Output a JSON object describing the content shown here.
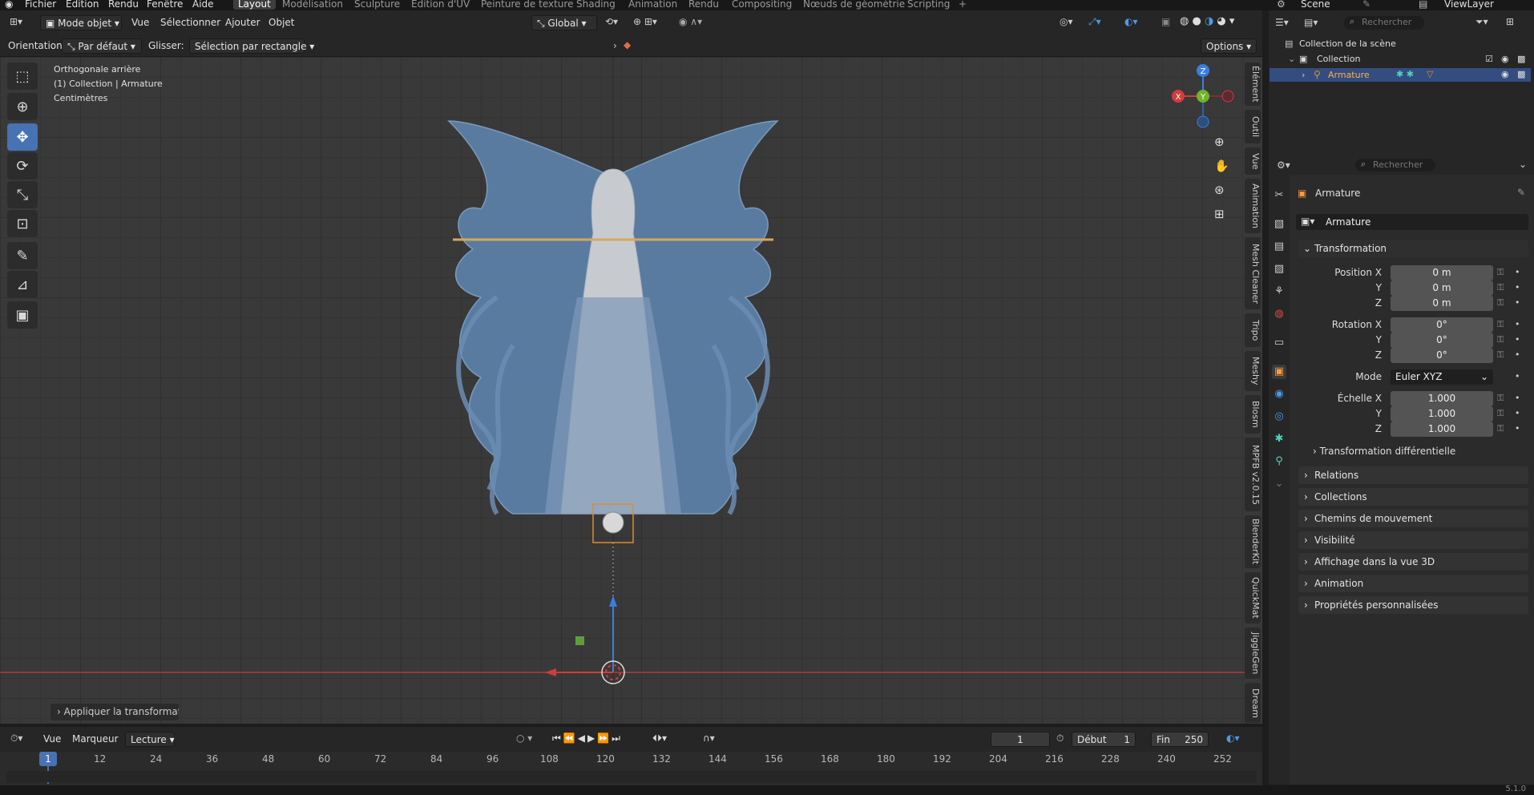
{
  "menubar": {
    "items": [
      "Fichier",
      "Edition",
      "Rendu",
      "Fenêtre",
      "Aide"
    ],
    "workspaces": [
      "Layout",
      "Modélisation",
      "Sculpture",
      "Edition d'UV",
      "Peinture de texture",
      "Shading",
      "Animation",
      "Rendu",
      "Compositing",
      "Nœuds de géométrie",
      "Scripting"
    ],
    "add_tab": "+",
    "scene": "Scene",
    "view_layer": "ViewLayer"
  },
  "viewport_header": {
    "mode": "Mode objet",
    "menus": [
      "Vue",
      "Sélectionner",
      "Ajouter",
      "Objet"
    ],
    "transform_orientation": "Global",
    "orientation_label": "Orientation:",
    "orientation_value": "Par défaut",
    "drag_label": "Glisser:",
    "drag_value": "Sélection par rectangle",
    "options": "Options"
  },
  "viewport_info": {
    "line1": "Orthogonale arrière",
    "line2": "(1) Collection | Armature",
    "line3": "Centimètres"
  },
  "side_tabs": [
    "Élément",
    "Outil",
    "Vue",
    "Animation",
    "Mesh Cleaner",
    "Tripo",
    "Meshy",
    "Blosm",
    "MPFB v2.0.15",
    "BlenderKit",
    "QuickMat",
    "JiggleGen",
    "Dream"
  ],
  "gizmo": {
    "z": "Z",
    "y": "Y",
    "x": "X"
  },
  "operator_panel": "Appliquer la transformati",
  "timeline": {
    "menus": [
      "Vue",
      "Marqueur",
      "Lecture"
    ],
    "current_frame": "1",
    "start_label": "Début",
    "start": "1",
    "end_label": "Fin",
    "end": "250",
    "ticks": [
      "1",
      "12",
      "24",
      "36",
      "48",
      "60",
      "72",
      "84",
      "96",
      "108",
      "120",
      "132",
      "144",
      "156",
      "168",
      "180",
      "192",
      "204",
      "216",
      "228",
      "240",
      "252"
    ]
  },
  "outliner": {
    "search_placeholder": "Rechercher",
    "scene_collection": "Collection de la scène",
    "collection": "Collection",
    "armature": "Armature"
  },
  "properties": {
    "search_placeholder": "Rechercher",
    "object_name": "Armature",
    "datablock": "Armature",
    "transform_title": "Transformation",
    "position_label": "Position X",
    "position": [
      "0 m",
      "0 m",
      "0 m"
    ],
    "rotation_label": "Rotation X",
    "rotation": [
      "0°",
      "0°",
      "0°"
    ],
    "mode_label": "Mode",
    "mode_value": "Euler XYZ",
    "scale_label": "Échelle X",
    "scale": [
      "1.000",
      "1.000",
      "1.000"
    ],
    "axis_y": "Y",
    "axis_z": "Z",
    "delta": "Transformation différentielle",
    "panels": [
      "Relations",
      "Collections",
      "Chemins de mouvement",
      "Visibilité",
      "Affichage dans la vue 3D",
      "Animation",
      "Propriétés personnalisées"
    ]
  },
  "version": "5.1.0"
}
